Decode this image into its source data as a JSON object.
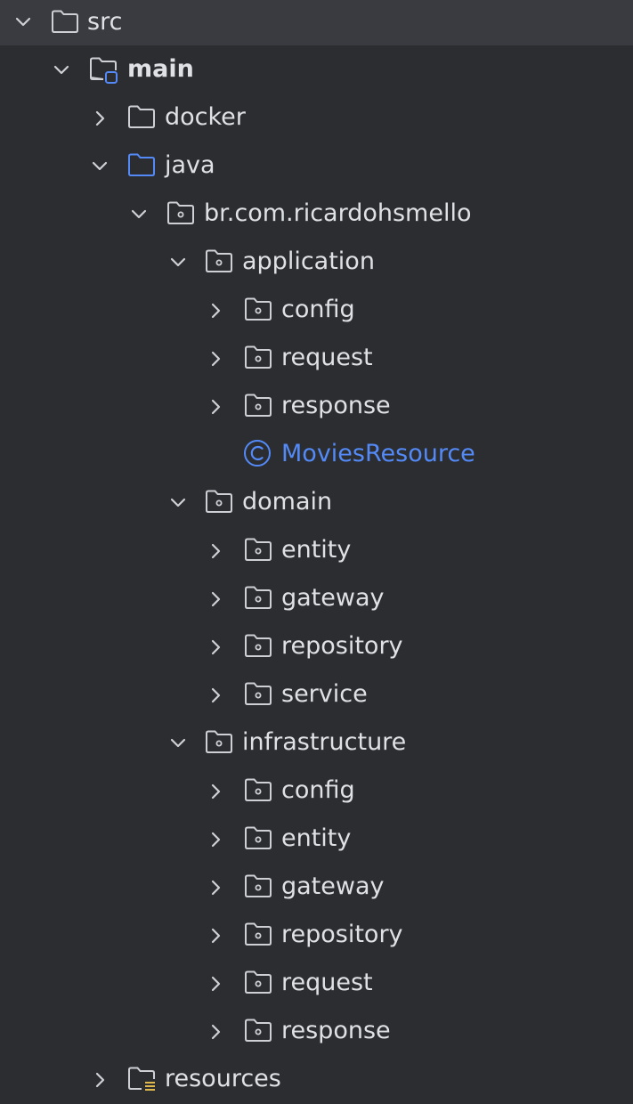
{
  "tree": {
    "src": {
      "label": "src",
      "icon": "folder-icon",
      "expanded": true,
      "selected": true
    },
    "main": {
      "label": "main",
      "icon": "module-source-folder-icon",
      "expanded": true
    },
    "docker": {
      "label": "docker",
      "icon": "folder-icon",
      "expanded": false
    },
    "java": {
      "label": "java",
      "icon": "source-root-folder-icon",
      "expanded": true
    },
    "pkg_root": {
      "label": "br.com.ricardohsmello",
      "icon": "package-icon",
      "expanded": true
    },
    "application": {
      "label": "application",
      "icon": "package-icon",
      "expanded": true,
      "children": [
        {
          "label": "config",
          "icon": "package-icon",
          "expanded": false
        },
        {
          "label": "request",
          "icon": "package-icon",
          "expanded": false
        },
        {
          "label": "response",
          "icon": "package-icon",
          "expanded": false
        }
      ],
      "class_item": {
        "label": "MoviesResource",
        "icon": "class-icon",
        "color": "#548af7"
      }
    },
    "domain": {
      "label": "domain",
      "icon": "package-icon",
      "expanded": true,
      "children": [
        {
          "label": "entity",
          "icon": "package-icon",
          "expanded": false
        },
        {
          "label": "gateway",
          "icon": "package-icon",
          "expanded": false
        },
        {
          "label": "repository",
          "icon": "package-icon",
          "expanded": false
        },
        {
          "label": "service",
          "icon": "package-icon",
          "expanded": false
        }
      ]
    },
    "infrastructure": {
      "label": "infrastructure",
      "icon": "package-icon",
      "expanded": true,
      "children": [
        {
          "label": "config",
          "icon": "package-icon",
          "expanded": false
        },
        {
          "label": "entity",
          "icon": "package-icon",
          "expanded": false
        },
        {
          "label": "gateway",
          "icon": "package-icon",
          "expanded": false
        },
        {
          "label": "repository",
          "icon": "package-icon",
          "expanded": false
        },
        {
          "label": "request",
          "icon": "package-icon",
          "expanded": false
        },
        {
          "label": "response",
          "icon": "package-icon",
          "expanded": false
        }
      ]
    },
    "resources": {
      "label": "resources",
      "icon": "resources-folder-icon",
      "expanded": false
    }
  },
  "colors": {
    "background": "#2b2d30",
    "selected_row": "#393b40",
    "text": "#dfe1e5",
    "icon_gray": "#ced0d6",
    "accent_blue": "#548af7",
    "resource_yellow": "#e0b84c"
  }
}
